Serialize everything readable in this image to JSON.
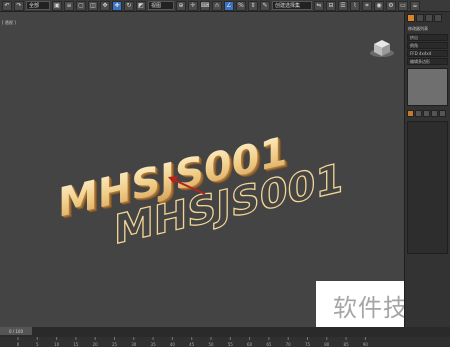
{
  "toolbar": {
    "selection_filter": "全部",
    "view_dropdown": "视图",
    "selection_set": "创建选择集"
  },
  "viewport": {
    "label": "[ 透视 ]",
    "text_front": "MHSJS001",
    "text_outline": "MHSJS001"
  },
  "command_panel": {
    "title": "修改器列表",
    "buttons": [
      "挤出",
      "倒角",
      "FFD 4x4x4",
      "编辑多边形"
    ]
  },
  "timeline": {
    "frame_range": "0 / 100",
    "ticks": [
      "0",
      "5",
      "10",
      "15",
      "20",
      "25",
      "30",
      "35",
      "40",
      "45",
      "50",
      "55",
      "60",
      "65",
      "70",
      "75",
      "80",
      "85",
      "90"
    ]
  },
  "watermark": {
    "text": "软件技巧"
  },
  "colors": {
    "gold": "#e4b666",
    "viewport_bg": "#444444",
    "toolbar_bg": "#3a3a3a",
    "accent_blue": "#3b74c7",
    "arrow_red": "#b4231e"
  },
  "icons": [
    "undo-icon",
    "redo-icon",
    "select-icon",
    "move-icon",
    "rotate-icon",
    "scale-icon",
    "snap-icon",
    "mirror-icon",
    "align-icon",
    "render-icon",
    "navigation-cube-icon"
  ]
}
